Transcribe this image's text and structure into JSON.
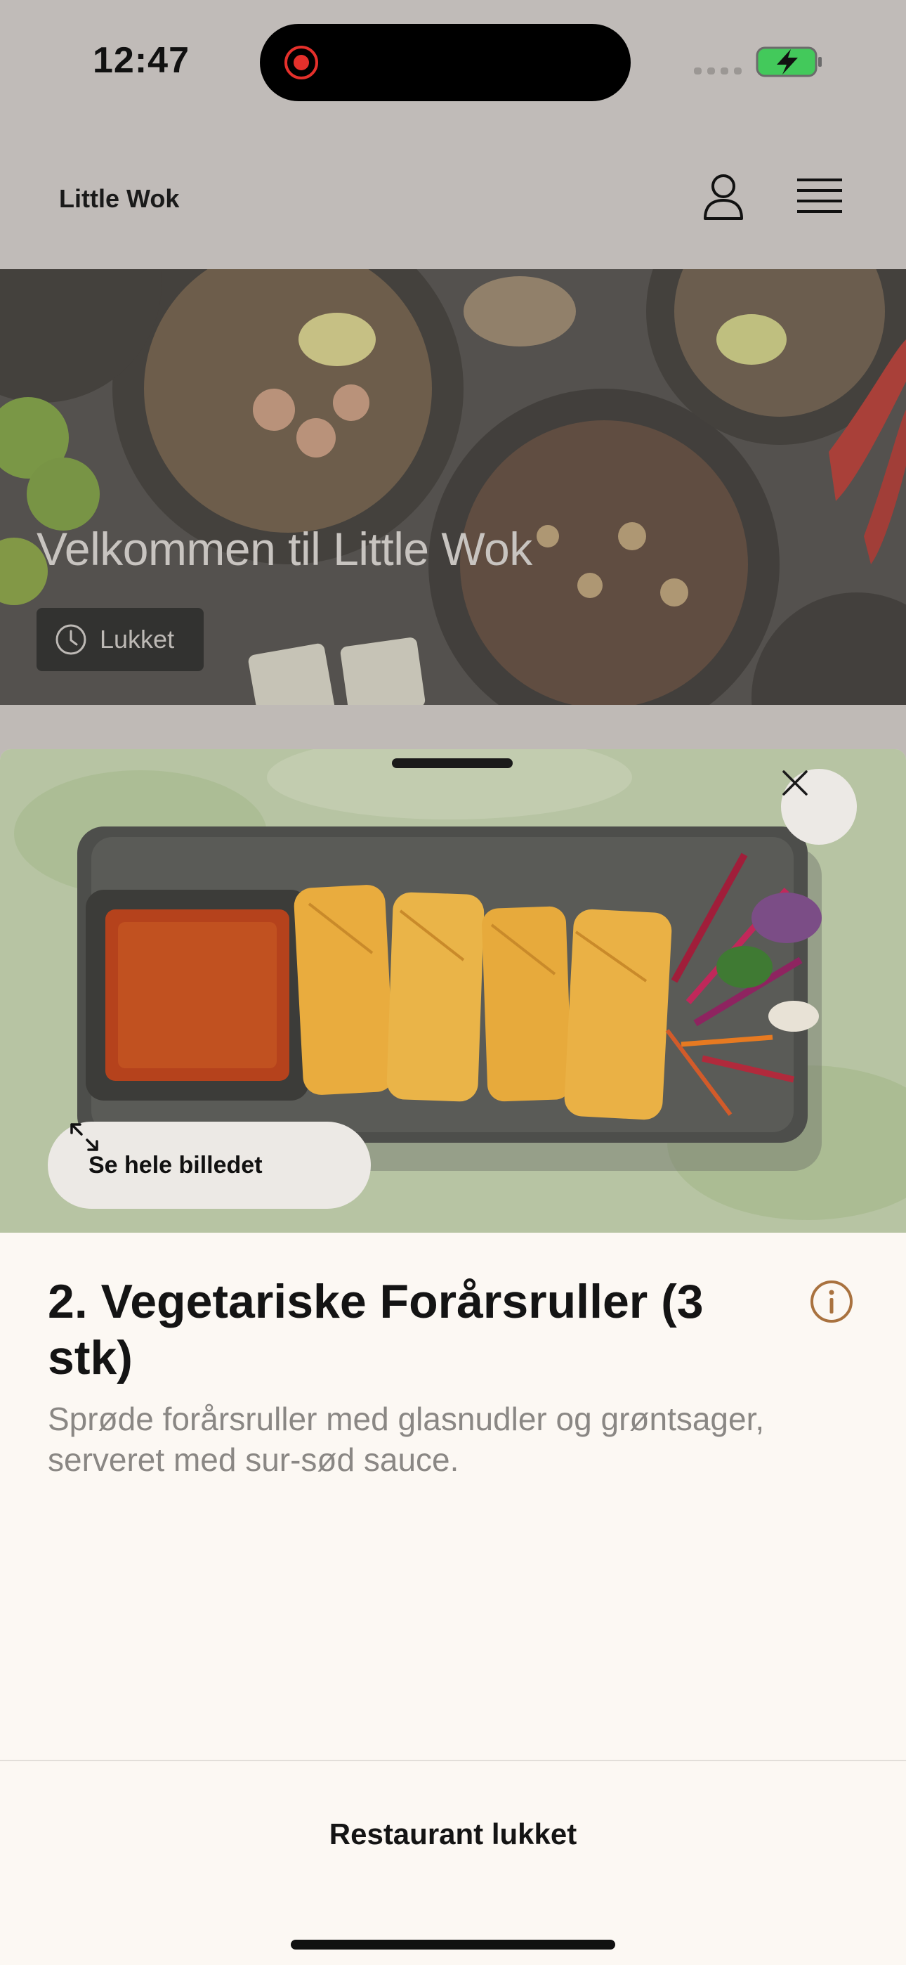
{
  "status_bar": {
    "time": "12:47"
  },
  "header": {
    "app_title": "Little Wok",
    "profile_icon": "user-icon",
    "menu_icon": "hamburger-menu-icon"
  },
  "hero": {
    "title": "Velkommen til Little Wok",
    "status_label": "Lukket",
    "status_icon": "clock-icon"
  },
  "item_sheet": {
    "view_image_label": "Se hele billedet",
    "close_icon": "close-icon",
    "expand_icon": "expand-icon",
    "info_icon": "info-icon",
    "title": "2. Vegetariske Forårsruller (3 stk)",
    "description": "Sprøde forårsruller med glasnudler og grøntsager, serveret med sur-sød sauce."
  },
  "footer": {
    "status": "Restaurant lukket"
  },
  "colors": {
    "header_bg": "#c0bbb8",
    "sheet_bg": "#fcf8f3",
    "accent_info": "#a9723f",
    "battery_green": "#43c95b",
    "recording_red": "#e5302b"
  }
}
